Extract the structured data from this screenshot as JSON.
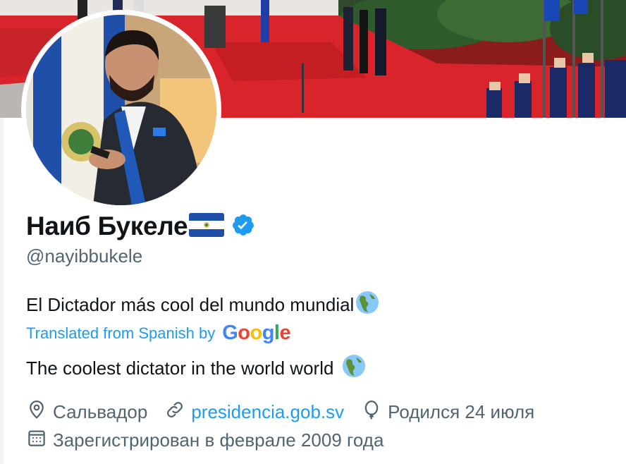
{
  "profile": {
    "display_name": "Наиб Букеле",
    "flag": "El Salvador flag",
    "verified": "verified-badge",
    "handle": "@nayibbukele",
    "bio": "El Dictador más cool del mundo mundial",
    "translation_label": "Translated from Spanish by",
    "translation_provider": "Google",
    "bio_translated": "The coolest dictator in the world world",
    "location": "Сальвадор",
    "website": "presidencia.gob.sv",
    "birthday": "Родился 24 июля",
    "joined": "Зарегистрирован в феврале 2009 года"
  },
  "icons": {
    "location": "location-pin-icon",
    "website": "link-icon",
    "birthday": "balloon-icon",
    "joined": "calendar-icon",
    "bio_emoji": "globe-americas-icon"
  },
  "colors": {
    "accent": "#1d9bf0",
    "text": "#0f1419",
    "secondary": "#536471",
    "banner_carpet": "#d8242a"
  }
}
